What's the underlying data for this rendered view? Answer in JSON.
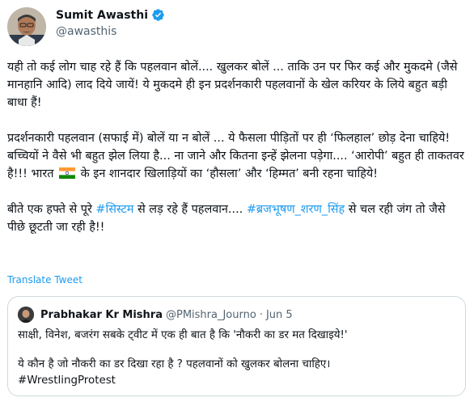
{
  "tweet": {
    "author_name": "Sumit Awasthi",
    "author_handle": "@awasthis",
    "verified": true,
    "paragraph1": "यही तो कई लोग चाह रहे हैं कि पहलवान बोलें.... खुलकर बोलें ... ताकि उन पर फिर कई और मुकदमे (जैसे मानहानि आदि) लाद दिये जायें! ये मुकदमे ही इन प्रदर्शनकारी पहलवानों के खेल करियर के लिये बहुत बड़ी बाधा हैं!",
    "paragraph2_a": "प्रदर्शनकारी पहलवान (सफाई में) बोलें या न बोलें ... ये फैसला पीड़ितों पर ही ‘फिलहाल’ छोड़ देना चाहिये! बच्चियों ने वैसे भी बहुत झेल लिया है... ना जाने और कितना इन्हें झेलना पड़ेगा.... ‘आरोपी’ बहुत ही ताकतवर है!!! भारत",
    "paragraph2_b": "के इन शानदार खिलाड़ियों का ‘हौसला’ और ‘हिम्मत’ बनी रहना चाहिये!",
    "paragraph3_a": "बीते एक हफ्ते से पूरे",
    "hashtag1": "#सिस्टम",
    "paragraph3_b": "से लड़ रहे हैं पहलवान....",
    "hashtag2": "#ब्रजभूषण_शरण_सिंह",
    "paragraph3_c": "से चल रही जंग तो जैसे पीछे छूटती जा रही है!!",
    "translate_label": "Translate Tweet"
  },
  "quote": {
    "author_name": "Prabhakar Kr Mishra",
    "author_handle": "@PMishra_Journo",
    "separator": "·",
    "date": "Jun 5",
    "line1": "साक्षी, विनेश, बजरंग सबके ट्वीट में एक ही बात है कि 'नौकरी का डर मत दिखाइये!'",
    "line2": "ये कौन है जो नौकरी का डर दिखा रहा है ? पहलवानों को खुलकर बोलना चाहिए।",
    "line3": "#WrestlingProtest"
  },
  "colors": {
    "link": "#1d9bf0",
    "secondary_text": "#536471",
    "border": "#cfd9de",
    "verified": "#1d9bf0"
  },
  "icons": [
    "verified-badge-icon",
    "india-flag-icon"
  ]
}
